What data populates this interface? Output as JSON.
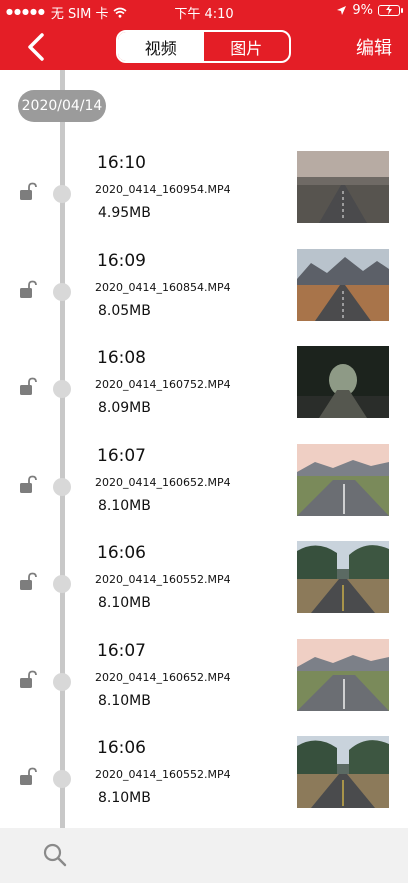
{
  "status_bar": {
    "carrier": "无 SIM 卡",
    "time": "下午 4:10",
    "battery": "9%"
  },
  "nav": {
    "back_icon": "chevron-left-icon",
    "tabs": [
      {
        "label": "视频",
        "active": true
      },
      {
        "label": "图片",
        "active": false
      }
    ],
    "edit_label": "编辑"
  },
  "colors": {
    "brand_red": "#e41e26",
    "timeline_gray": "#c8c8c8",
    "badge_gray": "#9b9b9b",
    "bottom_bar": "#f1f1f1"
  },
  "date_badge": "2020/04/14",
  "videos": [
    {
      "time": "16:10",
      "filename": "2020_0414_160954.MP4",
      "size": "4.95MB",
      "thumb": "road-hills-sunset"
    },
    {
      "time": "16:09",
      "filename": "2020_0414_160854.MP4",
      "size": "8.05MB",
      "thumb": "road-mountains"
    },
    {
      "time": "16:08",
      "filename": "2020_0414_160752.MP4",
      "size": "8.09MB",
      "thumb": "forest-tunnel"
    },
    {
      "time": "16:07",
      "filename": "2020_0414_160652.MP4",
      "size": "8.10MB",
      "thumb": "road-pink-sky"
    },
    {
      "time": "16:06",
      "filename": "2020_0414_160552.MP4",
      "size": "8.10MB",
      "thumb": "tree-lined-road"
    },
    {
      "time": "16:07",
      "filename": "2020_0414_160652.MP4",
      "size": "8.10MB",
      "thumb": "road-pink-sky"
    },
    {
      "time": "16:06",
      "filename": "2020_0414_160552.MP4",
      "size": "8.10MB",
      "thumb": "tree-lined-road"
    }
  ],
  "bottom": {
    "search_icon": "search-icon"
  }
}
